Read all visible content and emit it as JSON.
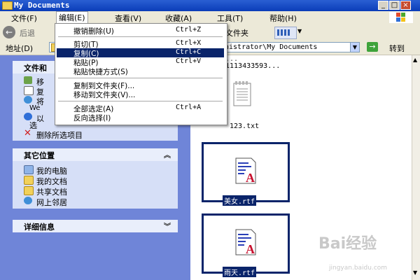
{
  "window": {
    "title": "My Documents"
  },
  "menubar": {
    "items": [
      "文件(F)",
      "编辑(E)",
      "查看(V)",
      "收藏(A)",
      "工具(T)",
      "帮助(H)"
    ]
  },
  "toolbar": {
    "back_label": "后退",
    "folders_label": "文件夹"
  },
  "address": {
    "label": "地址(D)",
    "path_visible": "nistrator\\My Documents",
    "go_label": "转到"
  },
  "edit_menu": {
    "items": [
      {
        "label": "撤销删除(U)",
        "shortcut": "Ctrl+Z"
      },
      {
        "label": "剪切(T)",
        "shortcut": "Ctrl+X"
      },
      {
        "label": "复制(C)",
        "shortcut": "Ctrl+C",
        "highlighted": true
      },
      {
        "label": "粘贴(P)",
        "shortcut": "Ctrl+V"
      },
      {
        "label": "粘贴快捷方式(S)",
        "shortcut": ""
      },
      {
        "label": "复制到文件夹(F)...",
        "shortcut": ""
      },
      {
        "label": "移动到文件夹(V)...",
        "shortcut": ""
      },
      {
        "label": "全部选定(A)",
        "shortcut": "Ctrl+A"
      },
      {
        "label": "反向选择(I)",
        "shortcut": ""
      }
    ]
  },
  "left_pane": {
    "file_tasks": {
      "title": "文件和",
      "items": [
        "移",
        "复",
        "将",
        "We",
        "以",
        "选",
        "删除所选项目"
      ]
    },
    "other_places": {
      "title": "其它位置",
      "items": [
        "我的电脑",
        "我的文档",
        "共享文档",
        "网上邻居"
      ]
    },
    "details": {
      "title": "详细信息"
    }
  },
  "files": {
    "top_fragment_1": "...",
    "top_fragment_2": "1113433593...",
    "items": [
      {
        "name": "123.txt",
        "selected": false
      },
      {
        "name": "美女.rtf",
        "selected": true
      },
      {
        "name": "雨天.rtf",
        "selected": true
      }
    ]
  },
  "watermark": {
    "text": "Bai经验",
    "url": "jingyan.baidu.com"
  },
  "colors": {
    "title_blue": "#0a3db8",
    "selection": "#0a246a",
    "pane_blue": "#6f85d8"
  }
}
